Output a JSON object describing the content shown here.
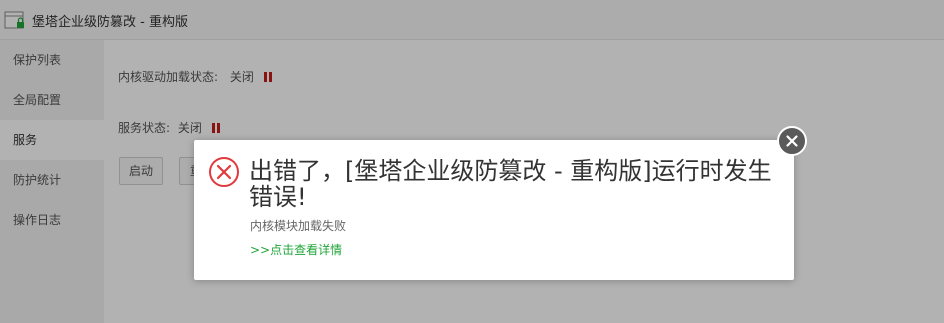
{
  "window": {
    "title": "堡塔企业级防篡改 - 重构版",
    "app_icon": "window-lock-icon"
  },
  "sidebar": {
    "items": [
      {
        "label": "保护列表",
        "active": false
      },
      {
        "label": "全局配置",
        "active": false
      },
      {
        "label": "服务",
        "active": true
      },
      {
        "label": "防护统计",
        "active": false
      },
      {
        "label": "操作日志",
        "active": false
      }
    ]
  },
  "main": {
    "kernel_status_label": "内核驱动加载状态:",
    "kernel_status_value": "关闭",
    "service_status_label": "服务状态:",
    "service_status_value": "关闭",
    "status_icon": "pause-icon",
    "status_color": "#c41a1a",
    "buttons": {
      "start": "启动",
      "restart_partial": "重"
    }
  },
  "dialog": {
    "icon": "error-circle-x-icon",
    "title": "出错了，[堡塔企业级防篡改 - 重构版]运行时发生错误!",
    "subtitle": "内核模块加载失败",
    "link": ">>点击查看详情",
    "close_icon": "close-x-icon",
    "colors": {
      "error": "#e0393e",
      "link": "#20a53a",
      "close_bg": "#5a5a5a"
    }
  }
}
